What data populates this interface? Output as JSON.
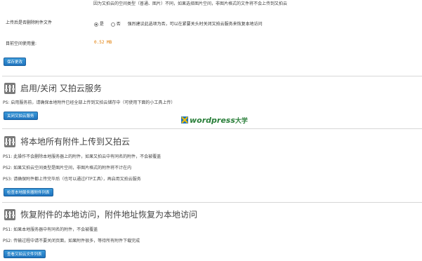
{
  "top_note": "因为又拍云的空间类型（普通、图片）不同，如果选择图片空间，非图片格式的文件将不会上传到又拍云",
  "delete_option": {
    "label": "上传后是否删除附件文件",
    "yes_label": "是",
    "no_label": "否",
    "hint": "强烈建议此选项为否，可以在紧要关头时关闭又拍云服务来恢复本地访问"
  },
  "usage": {
    "label": "目前空间使用量:",
    "value": "0.52 MB"
  },
  "save_button": "保存更改",
  "sections": [
    {
      "title": "启用/关闭 又拍云服务",
      "notes": [
        "PS: 启用服务前，请确保本地附件已经全部上传到又拍云储存中（可使用下面的小工具上传）"
      ],
      "button": "关闭又拍云服务"
    },
    {
      "title": "将本地所有附件上传到又拍云",
      "notes": [
        "PS1: 此操作不会删除本地服务器上的附件，如果又拍云中有同名的附件，不会被覆盖",
        "PS2: 如果又拍云空间类型是图片空间，非图片格式的附件将不计在内",
        "PS3: 请确保附件都上传完毕后（也可以通过FTP工具），再启用又拍云服务"
      ],
      "button": "检查本地服务器附件列表"
    },
    {
      "title": "恢复附件的本地访问，附件地址恢复为本地访问",
      "notes": [
        "PS1: 如果本地服务器中有同名的附件，不会被覆盖",
        "PS2: 传输过程中请不要关闭页面，如果附件很多，等待所有附件下载完成"
      ],
      "button": "查看又拍云文件列表"
    }
  ],
  "watermark": {
    "text": "wordpress",
    "suffix": "大学"
  }
}
